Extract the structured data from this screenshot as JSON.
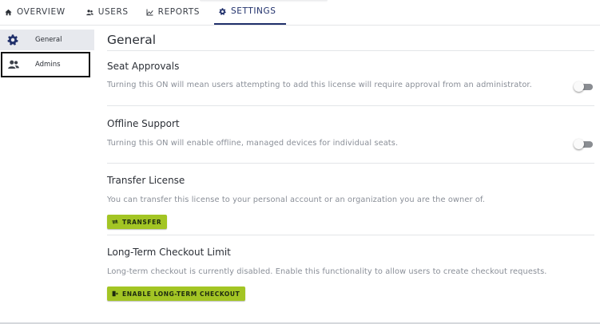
{
  "tabs": [
    {
      "label": "OVERVIEW",
      "icon": "home-icon"
    },
    {
      "label": "USERS",
      "icon": "users-icon"
    },
    {
      "label": "REPORTS",
      "icon": "reports-icon"
    },
    {
      "label": "SETTINGS",
      "icon": "gear-icon",
      "active": true
    }
  ],
  "sidebar": {
    "items": [
      {
        "label": "General",
        "icon": "gear-icon",
        "active": true
      },
      {
        "label": "Admins",
        "icon": "people-icon"
      }
    ]
  },
  "main": {
    "title": "General",
    "sections": [
      {
        "title": "Seat Approvals",
        "description": "Turning this ON will mean users attempting to add this license will require approval from an administrator.",
        "toggle": "off"
      },
      {
        "title": "Offline Support",
        "description": "Turning this ON will enable offline, managed devices for individual seats.",
        "toggle": "off"
      },
      {
        "title": "Transfer License",
        "description": "You can transfer this license to your personal account or an organization you are the owner of.",
        "button": "TRANSFER"
      },
      {
        "title": "Long-Term Checkout Limit",
        "description": "Long-term checkout is currently disabled. Enable this functionality to allow users to create checkout requests.",
        "button": "ENABLE LONG-TERM CHECKOUT"
      }
    ]
  },
  "colors": {
    "accent": "#20306b",
    "button": "#a3c524",
    "muted_text": "#8a8f98"
  }
}
